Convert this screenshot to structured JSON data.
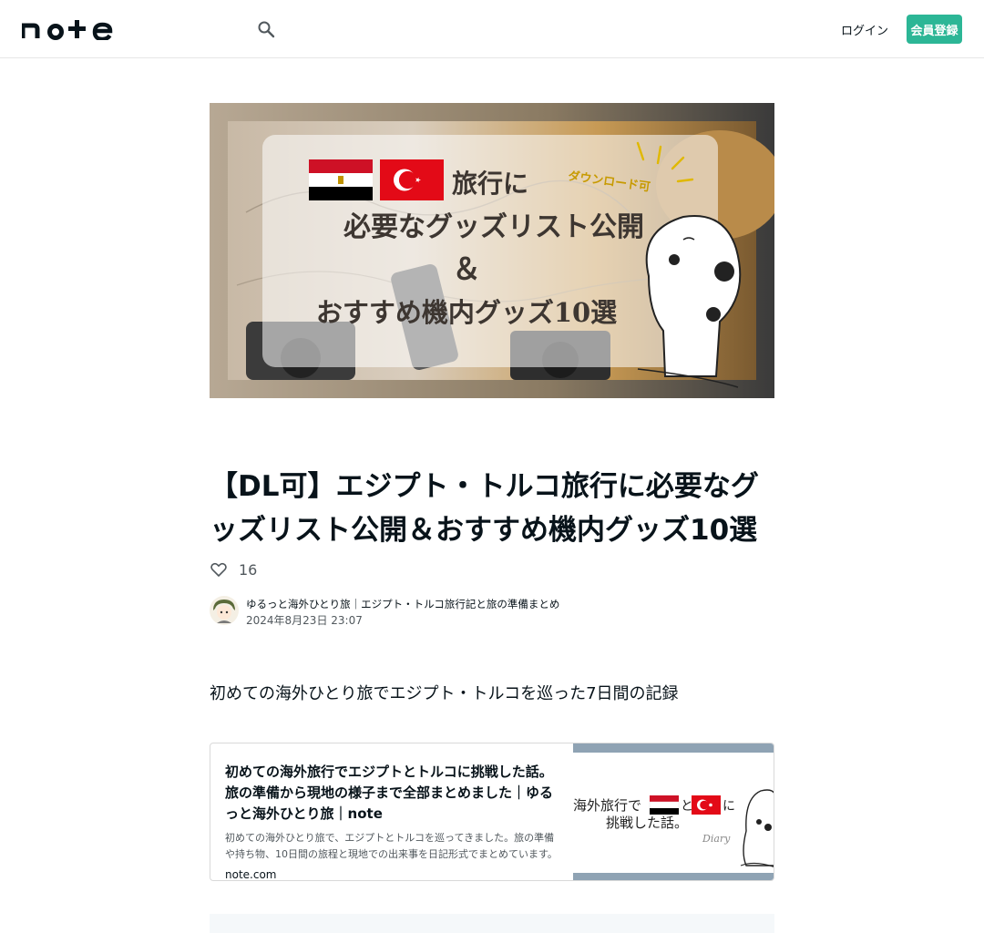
{
  "header": {
    "logo_text": "note",
    "login_label": "ログイン",
    "signup_label": "会員登録"
  },
  "eyecatch": {
    "line1": "旅行に",
    "line2": "必要なグッズリスト公開",
    "line3": "＆",
    "line4": "おすすめ機内グッズ10選",
    "badge": "ダウンロード可"
  },
  "article": {
    "title": "【DL可】エジプト・トルコ旅行に必要なグッズリスト公開＆おすすめ機内グッズ10選",
    "likes": "16",
    "author": "ゆるっと海外ひとり旅｜エジプト・トルコ旅行記と旅の準備まとめ",
    "date": "2024年8月23日 23:07",
    "lead": "初めての海外ひとり旅でエジプト・トルコを巡った7日間の記録"
  },
  "embed": {
    "title": "初めての海外旅行でエジプトとトルコに挑戦した話。旅の準備から現地の様子まで全部まとめました｜ゆるっと海外ひとり旅｜note",
    "description": "初めての海外ひとり旅で、エジプトとトルコを巡ってきました。旅の準備や持ち物、10日間の旅程と現地での出来事を日記形式でまとめています。",
    "host": "note.com",
    "thumb_line1": "海外旅行で",
    "thumb_line2": "挑戦した話。",
    "thumb_and": "と",
    "thumb_ni": "に",
    "thumb_sig": "Diary"
  },
  "colors": {
    "accent": "#2cb696",
    "text": "#08131a",
    "subtext": "#51585d"
  },
  "icons": {
    "search": "search-icon",
    "like": "heart-icon"
  }
}
